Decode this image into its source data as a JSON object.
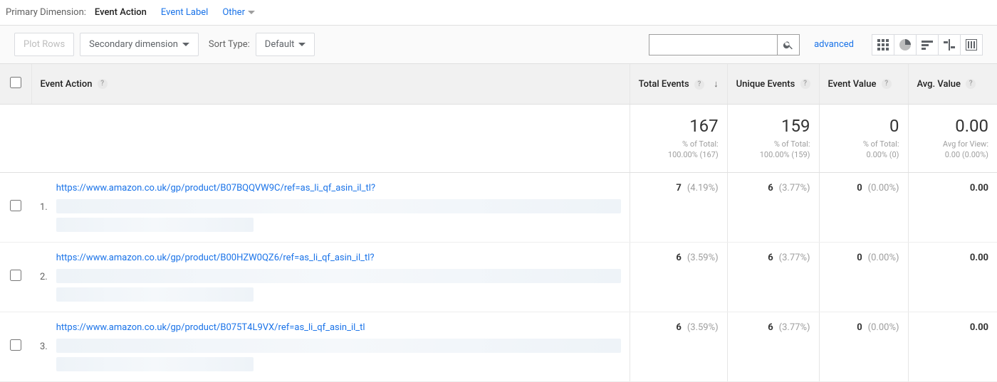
{
  "primary_dimension": {
    "label": "Primary Dimension:",
    "active": "Event Action",
    "tabs": {
      "event_label": "Event Label",
      "other": "Other"
    }
  },
  "toolbar": {
    "plot_rows": "Plot Rows",
    "secondary_dimension": "Secondary dimension",
    "sort_type_label": "Sort Type:",
    "sort_type_value": "Default",
    "search_placeholder": "",
    "advanced": "advanced"
  },
  "headers": {
    "event_action": "Event Action",
    "total_events": "Total Events",
    "unique_events": "Unique Events",
    "event_value": "Event Value",
    "avg_value": "Avg. Value"
  },
  "summary": {
    "total_events": {
      "value": "167",
      "sub1": "% of Total:",
      "sub2": "100.00% (167)"
    },
    "unique_events": {
      "value": "159",
      "sub1": "% of Total:",
      "sub2": "100.00% (159)"
    },
    "event_value": {
      "value": "0",
      "sub1": "% of Total:",
      "sub2": "0.00% (0)"
    },
    "avg_value": {
      "value": "0.00",
      "sub1": "Avg for View:",
      "sub2": "0.00 (0.00%)"
    }
  },
  "rows": [
    {
      "n": "1.",
      "url": "https://www.amazon.co.uk/gp/product/B07BQQVW9C/ref=as_li_qf_asin_il_tl?",
      "total": "7",
      "total_pct": "(4.19%)",
      "unique": "6",
      "unique_pct": "(3.77%)",
      "value": "0",
      "value_pct": "(0.00%)",
      "avg": "0.00"
    },
    {
      "n": "2.",
      "url": "https://www.amazon.co.uk/gp/product/B00HZW0QZ6/ref=as_li_qf_asin_il_tl?",
      "total": "6",
      "total_pct": "(3.59%)",
      "unique": "6",
      "unique_pct": "(3.77%)",
      "value": "0",
      "value_pct": "(0.00%)",
      "avg": "0.00"
    },
    {
      "n": "3.",
      "url": "https://www.amazon.co.uk/gp/product/B075T4L9VX/ref=as_li_qf_asin_il_tl",
      "total": "6",
      "total_pct": "(3.59%)",
      "unique": "6",
      "unique_pct": "(3.77%)",
      "value": "0",
      "value_pct": "(0.00%)",
      "avg": "0.00"
    }
  ]
}
